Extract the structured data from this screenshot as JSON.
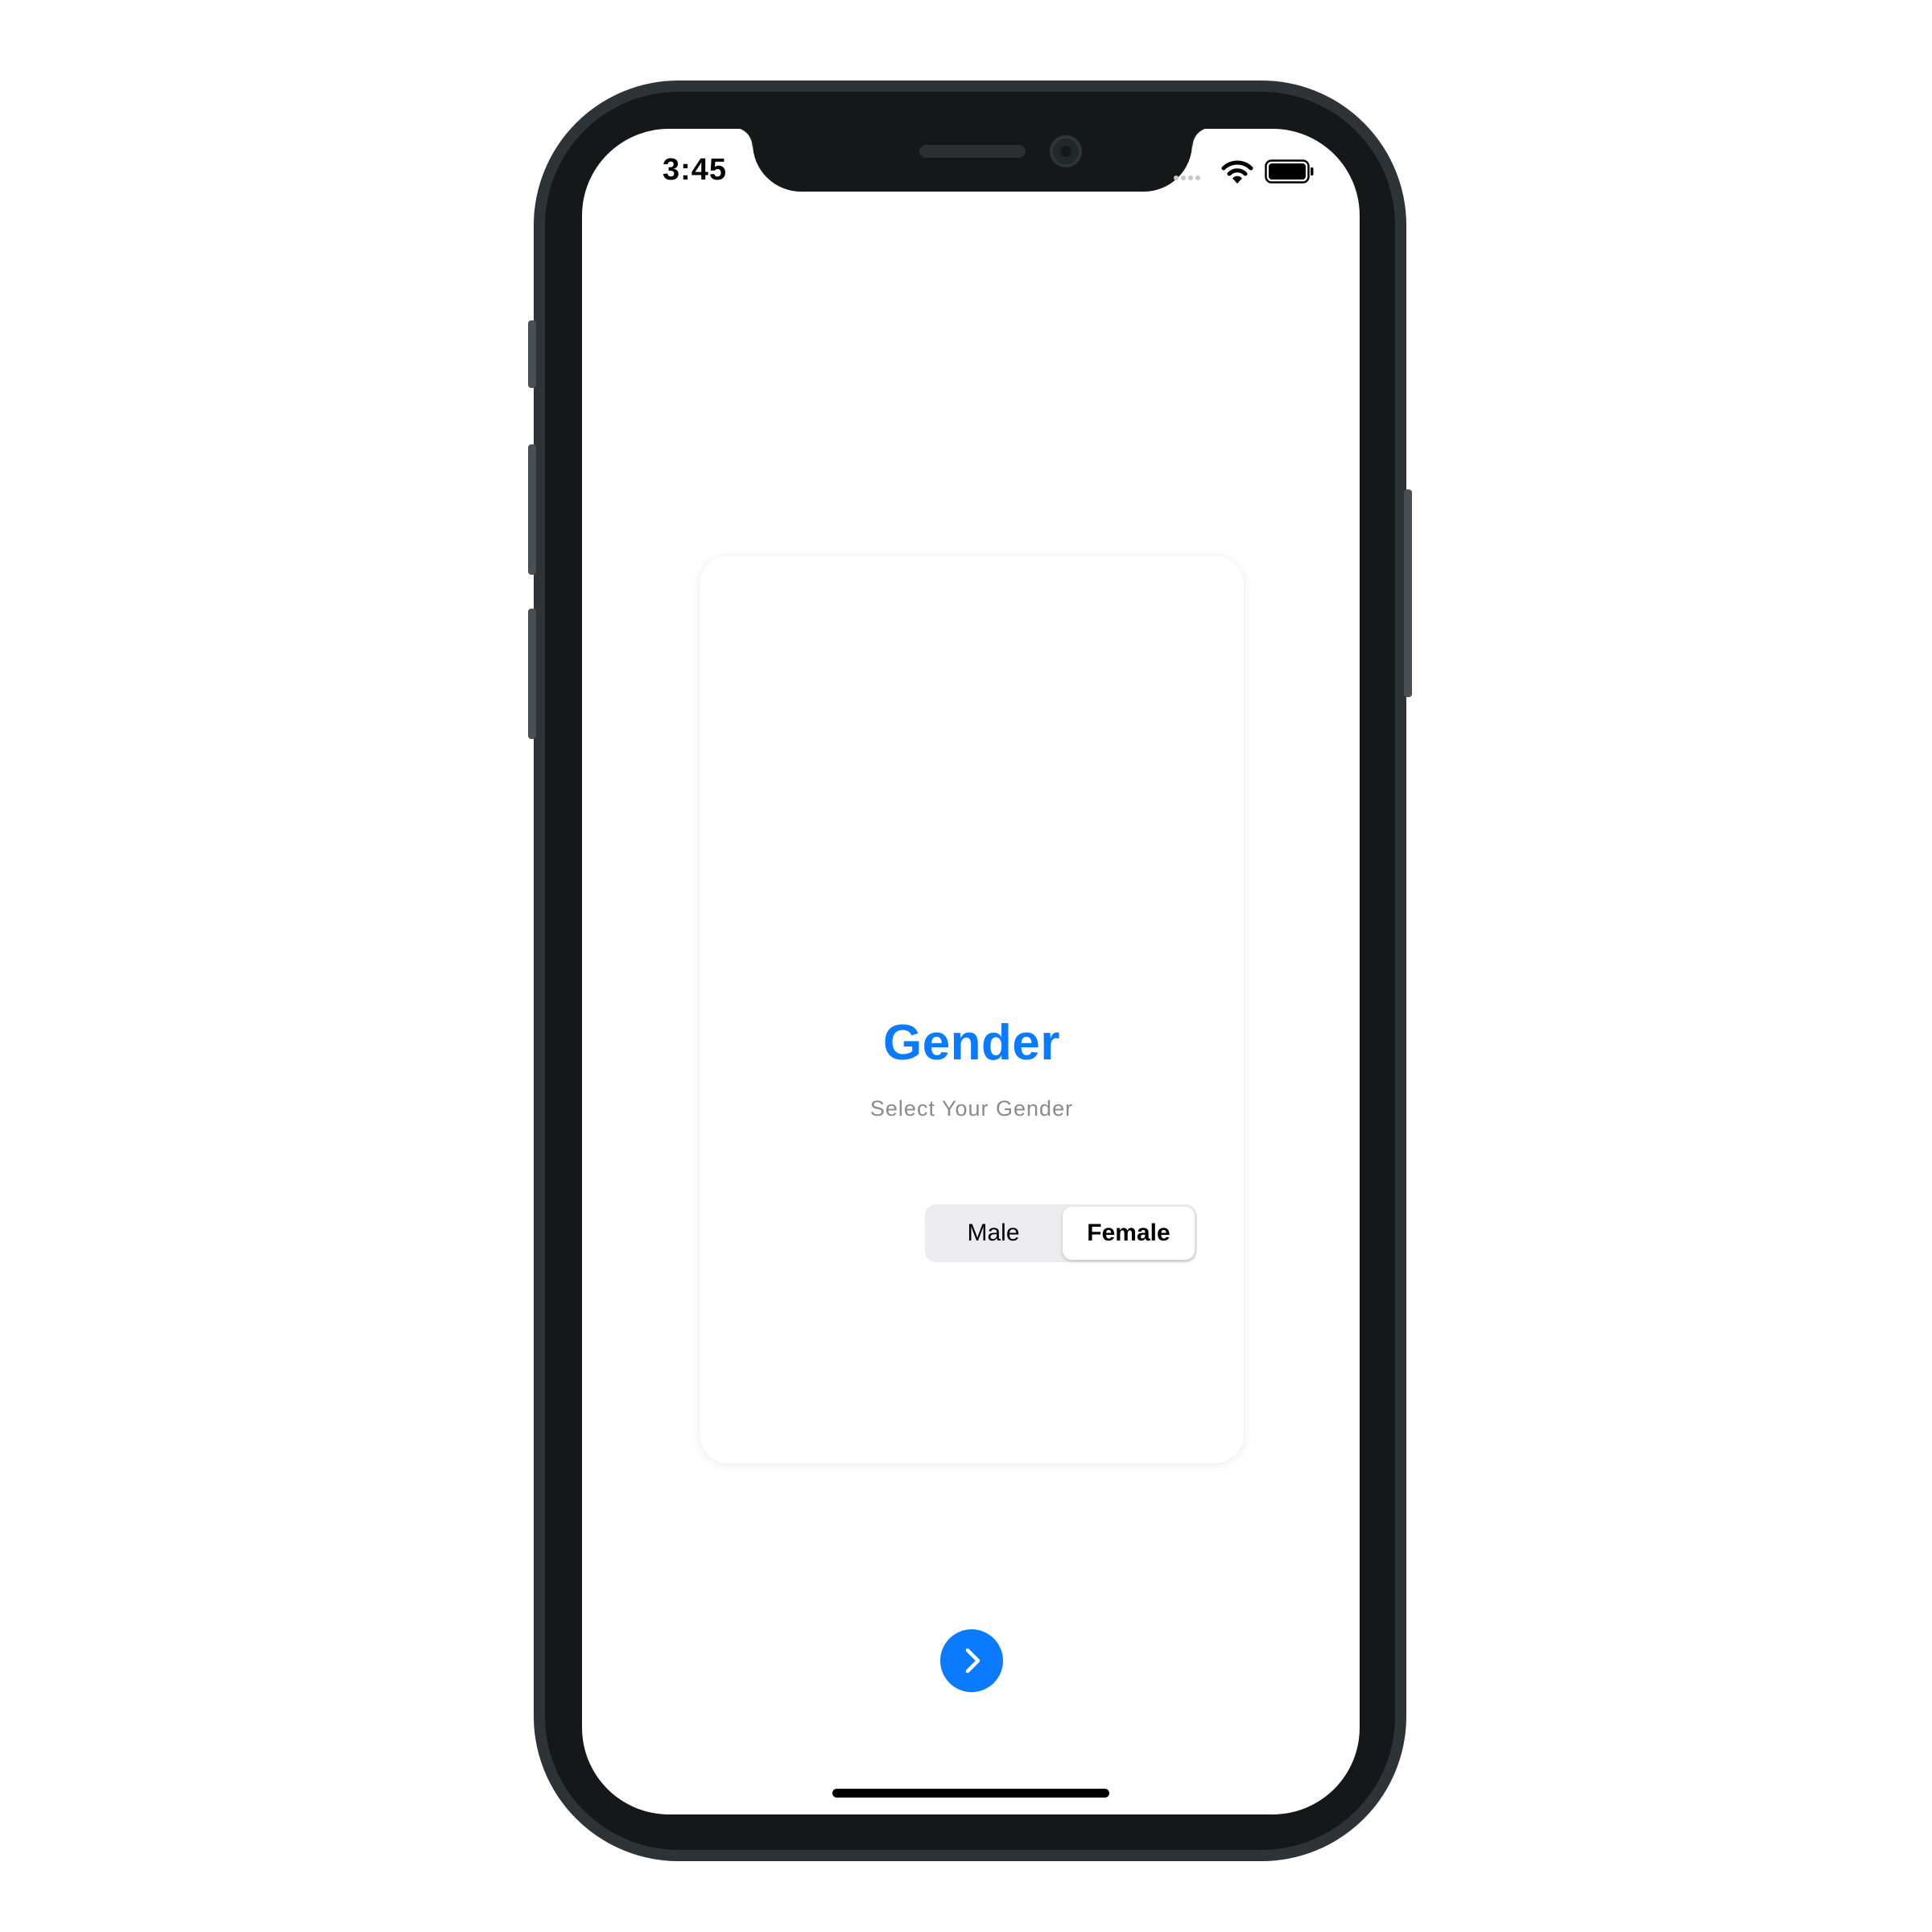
{
  "status_bar": {
    "time": "3:45",
    "icons": [
      "signal-icon",
      "wifi-icon",
      "battery-icon"
    ]
  },
  "card": {
    "title": "Gender",
    "subtitle": "Select Your Gender",
    "options": [
      "Male",
      "Female"
    ],
    "selected": "Female"
  },
  "next_button": {
    "icon": "chevron-right-icon"
  },
  "colors": {
    "accent": "#0a7aff",
    "subtitle": "#8a8a8e",
    "segment_background": "#ececee",
    "phone_frame": "#141819"
  }
}
